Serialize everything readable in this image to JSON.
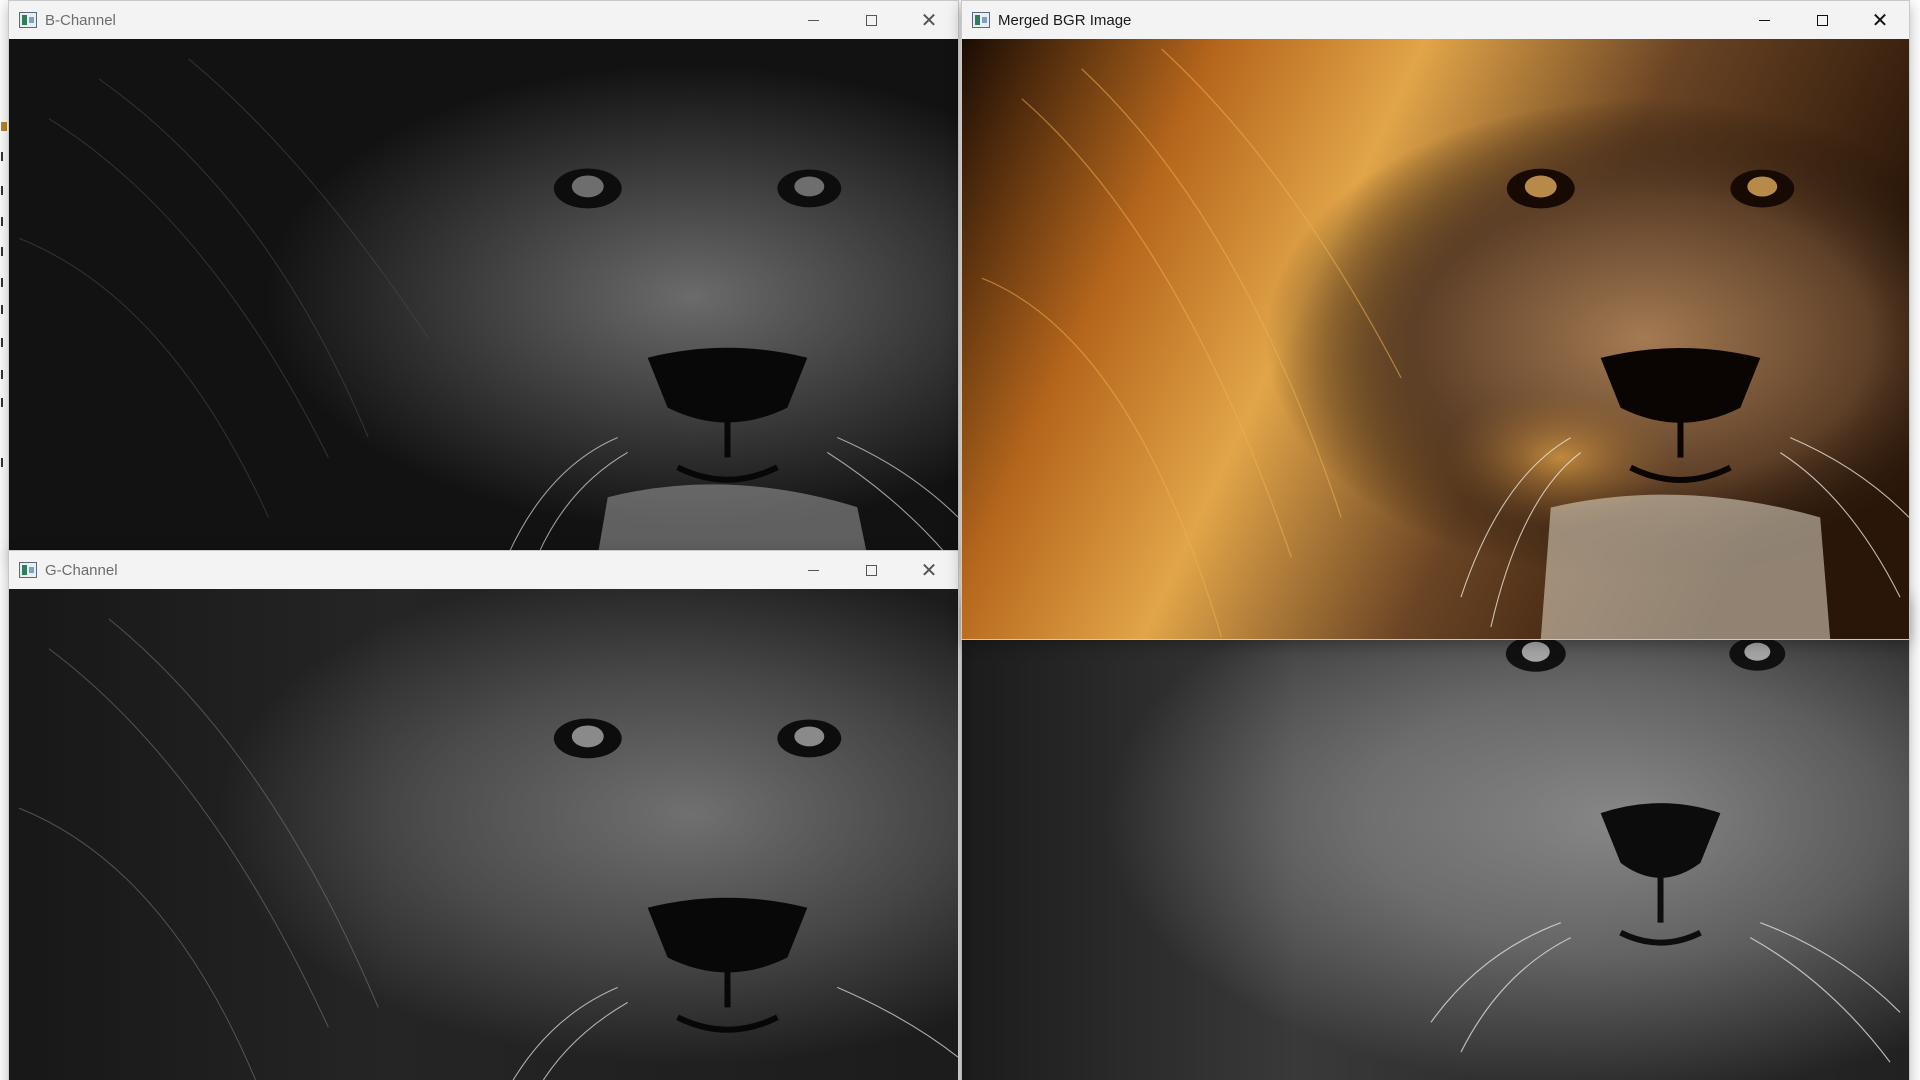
{
  "windows": {
    "b_channel": {
      "title": "B-Channel"
    },
    "g_channel": {
      "title": "G-Channel"
    },
    "merged": {
      "title": "Merged BGR Image"
    },
    "r_channel": {
      "title": ""
    }
  },
  "controls": {
    "minimize": "—",
    "maximize": "☐",
    "close": "✕"
  },
  "colors": {
    "titlebar": "#f3f3f3",
    "merged_mane": "#b5661c",
    "merged_highlight": "#e2a548"
  },
  "icons": [
    "app-icon",
    "minimize-icon",
    "maximize-icon",
    "close-icon"
  ]
}
